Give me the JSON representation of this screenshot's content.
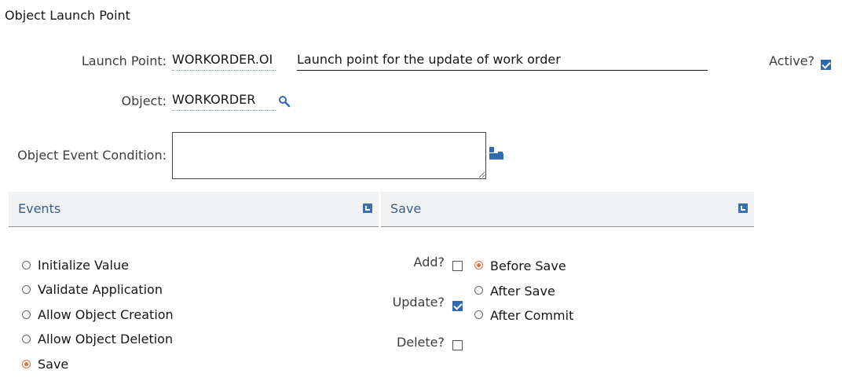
{
  "page": {
    "title": "Object Launch Point"
  },
  "launch_point": {
    "label": "Launch Point:",
    "value": "WORKORDER.OI",
    "description": "Launch point for the update of work order",
    "active_label": "Active?",
    "active_checked": true
  },
  "object": {
    "label": "Object:",
    "value": "WORKORDER",
    "lookup_icon": "search-icon"
  },
  "event_condition": {
    "label": "Object Event Condition:",
    "value": "",
    "builder_icon": "condition-builder-icon"
  },
  "sections": {
    "events": {
      "title": "Events",
      "icon": "expand-icon"
    },
    "save": {
      "title": "Save",
      "icon": "expand-icon"
    }
  },
  "events": {
    "options": [
      {
        "label": "Initialize Value",
        "selected": false
      },
      {
        "label": "Validate Application",
        "selected": false
      },
      {
        "label": "Allow Object Creation",
        "selected": false
      },
      {
        "label": "Allow Object Deletion",
        "selected": false
      },
      {
        "label": "Save",
        "selected": true
      }
    ]
  },
  "save": {
    "checks": [
      {
        "label": "Add?",
        "checked": false
      },
      {
        "label": "Update?",
        "checked": true
      },
      {
        "label": "Delete?",
        "checked": false
      }
    ],
    "options": [
      {
        "label": "Before Save",
        "selected": true
      },
      {
        "label": "After Save",
        "selected": false
      },
      {
        "label": "After Commit",
        "selected": false
      }
    ]
  },
  "colors": {
    "accent": "#2f69b2",
    "radio_selected": "#e0703c",
    "section_header": "#f1f2f4",
    "section_title": "#3a5f8a"
  }
}
